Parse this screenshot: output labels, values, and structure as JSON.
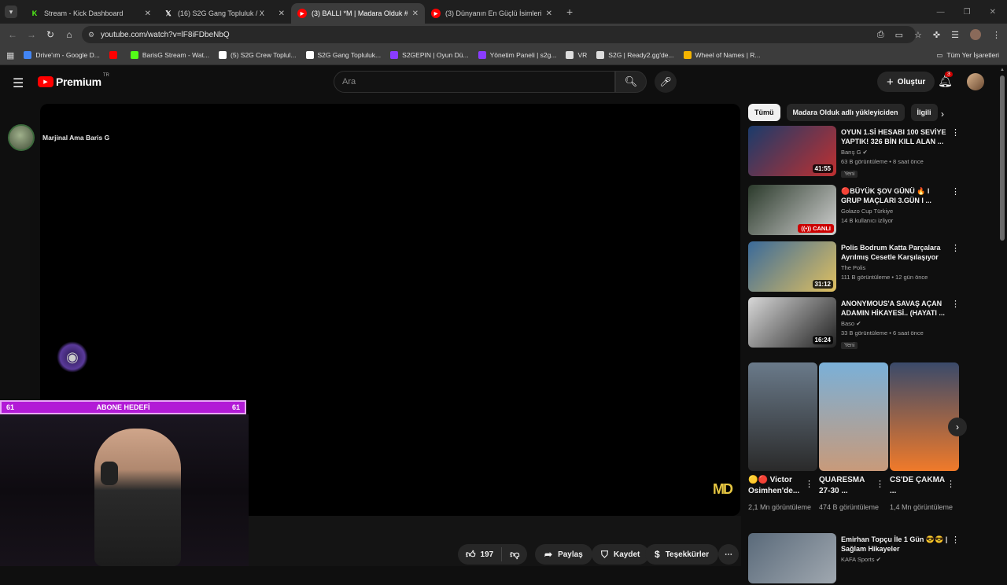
{
  "browser": {
    "tabs": [
      {
        "title": "Stream - Kick Dashboard",
        "icon": "kick-icon",
        "icon_glyph": "K",
        "color": "#53fc18",
        "active": false
      },
      {
        "title": "(16) S2G Gang Topluluk / X",
        "icon": "x-icon",
        "icon_glyph": "𝕏",
        "color": "#ffffff",
        "active": false
      },
      {
        "title": "(3) BALLI *M | Madara Olduk #",
        "icon": "youtube-icon",
        "icon_glyph": "▶",
        "color": "#ff0000",
        "active": true
      },
      {
        "title": "(3) Dünyanın En Güçlü İsimleri",
        "icon": "youtube-icon",
        "icon_glyph": "▶",
        "color": "#ff0000",
        "active": false
      }
    ],
    "url": "youtube.com/watch?v=lF8iFDbeNbQ",
    "bookmarks": [
      {
        "label": "Drive'ım - Google D...",
        "icon": "drive-icon",
        "color": "#4285f4"
      },
      {
        "label": "",
        "icon": "youtube-icon",
        "color": "#ff0000"
      },
      {
        "label": "BarisG Stream - Wat...",
        "icon": "kick-icon",
        "color": "#53fc18"
      },
      {
        "label": "(5) S2G Crew Toplul...",
        "icon": "x-icon",
        "color": "#ffffff"
      },
      {
        "label": "S2G Gang Topluluk...",
        "icon": "x-icon",
        "color": "#ffffff"
      },
      {
        "label": "S2GEPIN | Oyun Dü...",
        "icon": "s2g-icon",
        "color": "#8a3cff"
      },
      {
        "label": "Yönetim Paneli | s2g...",
        "icon": "s2g-icon",
        "color": "#8a3cff"
      },
      {
        "label": "VR",
        "icon": "vr-icon",
        "color": "#dddddd"
      },
      {
        "label": "S2G | Ready2.gg'de...",
        "icon": "globe-icon",
        "color": "#dddddd"
      },
      {
        "label": "Wheel of Names | R...",
        "icon": "wheel-icon",
        "color": "#f4b400"
      }
    ],
    "all_bookmarks": "Tüm Yer İşaretleri"
  },
  "youtube": {
    "logo_text": "Premium",
    "logo_country": "TR",
    "search_placeholder": "Ara",
    "create_label": "Oluştur",
    "notification_count": "3"
  },
  "video": {
    "channel_overlay_name": "Marjinal Ama Baris G",
    "subscriber_goal": {
      "left": "61",
      "label": "ABONE HEDEFİ",
      "right": "61"
    },
    "watermark": "MD",
    "actions": {
      "likes": "197",
      "share": "Paylaş",
      "save": "Kaydet",
      "thanks": "Teşekkürler"
    }
  },
  "sidebar": {
    "chips": [
      "Tümü",
      "Madara Olduk adlı yükleyiciden",
      "İlgili"
    ],
    "recommendations": [
      {
        "title": "OYUN 1.Sİ HESABI 100 SEVİYE YAPTIK! 326 BİN KILL ALAN ...",
        "channel": "Barış G",
        "verified": true,
        "meta": "63 B görüntüleme • 8 saat önce",
        "badge": "Yeni",
        "duration": "41:55",
        "live": "",
        "thumb_colors": [
          "#1a3b6b",
          "#c03030"
        ]
      },
      {
        "title": "🔴BÜYÜK ŞOV GÜNÜ 🔥 I GRUP MAÇLARI 3.GÜN I ...",
        "channel": "Golazo Cup Türkiye",
        "verified": false,
        "meta": "14 B kullanıcı izliyor",
        "badge": "",
        "duration": "",
        "live": "CANLI",
        "thumb_colors": [
          "#2b3a2b",
          "#d0d0d0"
        ]
      },
      {
        "title": "Polis Bodrum Katta Parçalara Ayrılmış Cesetle Karşılaşıyor",
        "channel": "The Polis",
        "verified": false,
        "meta": "111 B görüntüleme • 12 gün önce",
        "badge": "",
        "duration": "31:12",
        "live": "",
        "thumb_colors": [
          "#3a6a9a",
          "#e0c060"
        ]
      },
      {
        "title": "ANONYMOUS'A SAVAŞ AÇAN ADAMIN HİKAYESİ.. (HAYATI ...",
        "channel": "Baso",
        "verified": true,
        "meta": "33 B görüntüleme • 6 saat önce",
        "badge": "Yeni",
        "duration": "16:24",
        "live": "",
        "thumb_colors": [
          "#d8d8d8",
          "#202020"
        ]
      }
    ],
    "shorts": [
      {
        "title": "🟡🔴 Victor Osimhen'de...",
        "views": "2,1 Mn görüntüleme",
        "thumb_colors": [
          "#6a7a8a",
          "#2a2a2a"
        ]
      },
      {
        "title": "QUARESMA 27-30 ...",
        "views": "474 B görüntüleme",
        "thumb_colors": [
          "#7ab0d8",
          "#c89a7a"
        ]
      },
      {
        "title": "CS'DE ÇAKMA ...",
        "views": "1,4 Mn görüntüleme",
        "thumb_colors": [
          "#3a4a6a",
          "#f07a2a"
        ]
      }
    ],
    "last_rec": {
      "title": "Emirhan Topçu İle 1 Gün 😎😎 | Sağlam Hikayeler",
      "channel": "KAFA Sports",
      "verified": true,
      "thumb_colors": [
        "#5a6a7a",
        "#a0a8b0"
      ]
    }
  }
}
